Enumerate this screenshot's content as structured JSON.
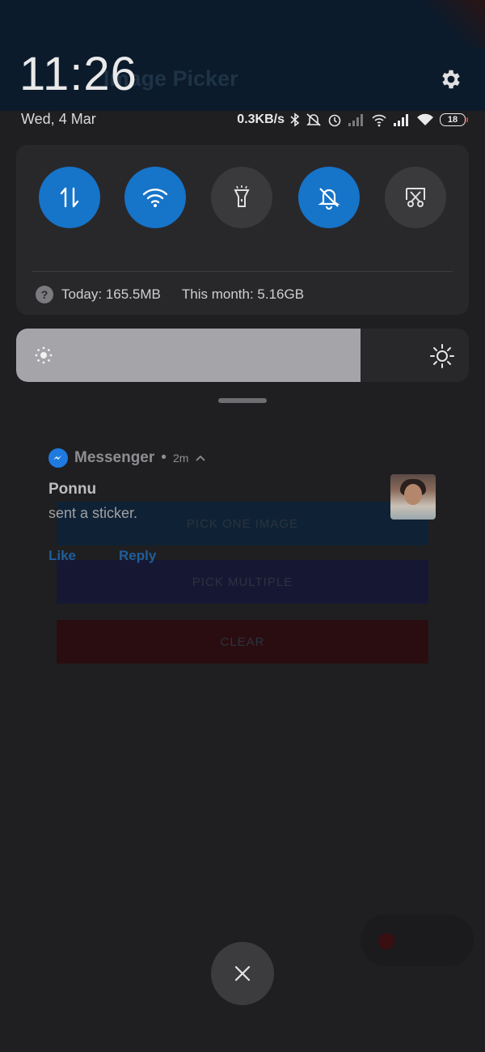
{
  "background_app": {
    "title": "Image Picker",
    "buttons": [
      "PICK ONE IMAGE",
      "PICK MULTIPLE",
      "CLEAR"
    ]
  },
  "status": {
    "time": "11:26",
    "date": "Wed, 4 Mar",
    "speed": "0.3KB/s",
    "battery": "18",
    "icons": [
      "bluetooth-icon",
      "mute-icon",
      "alarm-icon",
      "signal-icon",
      "hotspot-icon",
      "signal-icon",
      "wifi-icon",
      "battery-icon"
    ]
  },
  "quick_settings": {
    "tiles": [
      {
        "name": "mobile-data",
        "state": "on",
        "icon": "data-arrows-icon"
      },
      {
        "name": "wifi",
        "state": "on",
        "icon": "wifi-icon"
      },
      {
        "name": "flashlight",
        "state": "off",
        "icon": "flashlight-icon"
      },
      {
        "name": "mute",
        "state": "on",
        "icon": "bell-off-icon"
      },
      {
        "name": "screenshot",
        "state": "off",
        "icon": "scissors-icon"
      }
    ],
    "usage_today": "Today: 165.5MB",
    "usage_month": "This month: 5.16GB"
  },
  "brightness": {
    "level": 0.76
  },
  "notification": {
    "app": "Messenger",
    "time": "2m",
    "sender": "Ponnu",
    "message": "sent a sticker.",
    "actions": [
      "Like",
      "Reply"
    ]
  },
  "colors": {
    "accent": "#1674c9",
    "tile_off": "#3a3a3d",
    "card": "#28282b"
  }
}
